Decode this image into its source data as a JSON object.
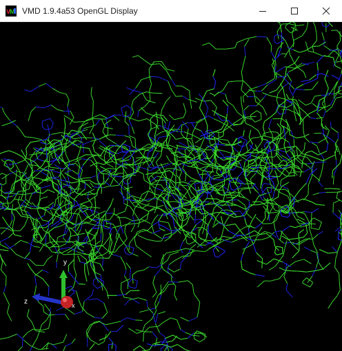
{
  "window": {
    "title": "VMD 1.9.4a53 OpenGL Display",
    "controls": {
      "minimize": "minimize-icon",
      "maximize": "maximize-icon",
      "close": "close-icon"
    }
  },
  "display": {
    "background_color": "#000000",
    "bond_colors": {
      "carbon": "#39d32c",
      "nitrogen": "#1e22e0"
    },
    "representation": "lines"
  },
  "axes_indicator": {
    "x_label": "x",
    "y_label": "y",
    "z_label": "z",
    "colors": {
      "x": "#d4282a",
      "y": "#2fbf2f",
      "z": "#2433c8"
    }
  }
}
